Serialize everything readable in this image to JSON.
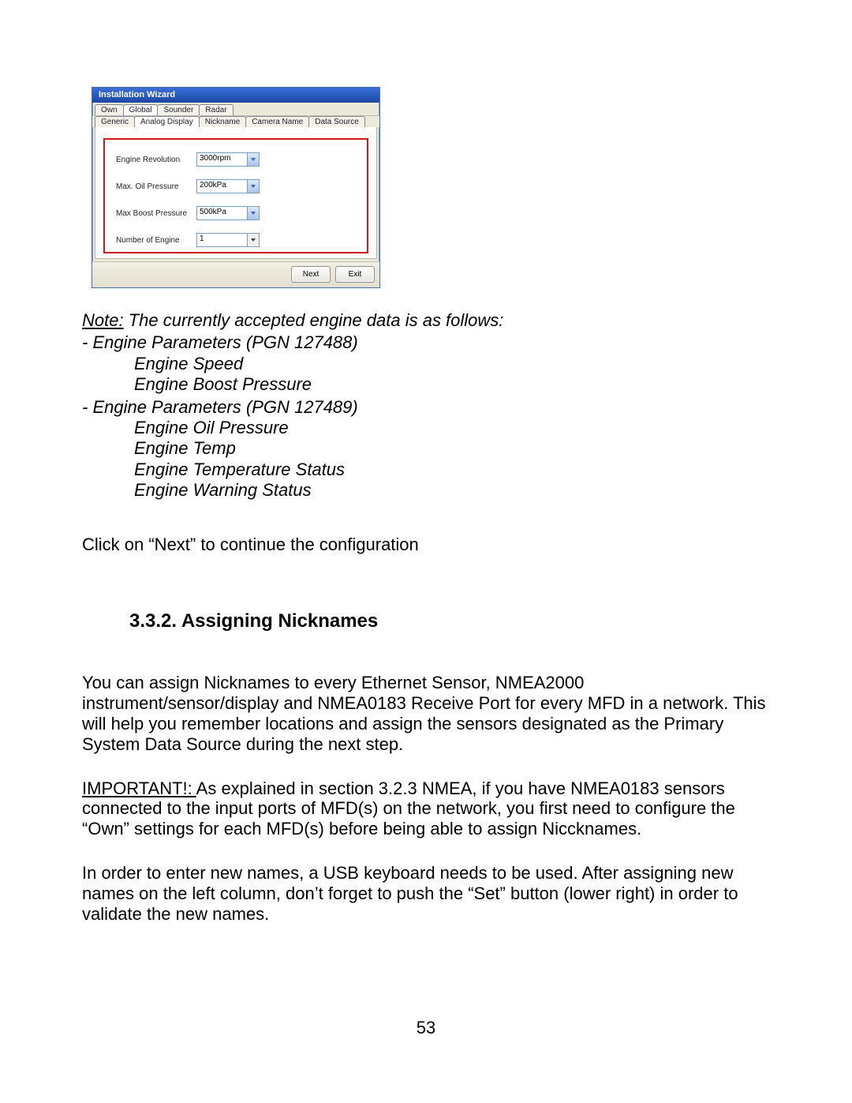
{
  "wizard": {
    "title": "Installation Wizard",
    "tabs_top": [
      "Own",
      "Global",
      "Sounder",
      "Radar"
    ],
    "active_top_index": 1,
    "tabs_sub": [
      "Generic",
      "Analog Display",
      "Nickname",
      "Camera Name",
      "Data Source"
    ],
    "active_sub_index": 1,
    "fields": [
      {
        "label": "Engine Revolution",
        "value": "3000rpm",
        "style": "blue"
      },
      {
        "label": "Max. Oil Pressure",
        "value": "200kPa",
        "style": "blue"
      },
      {
        "label": "Max Boost Pressure",
        "value": "500kPa",
        "style": "blue"
      },
      {
        "label": "Number of Engine",
        "value": "1",
        "style": "gray"
      }
    ],
    "buttons": {
      "next": "Next",
      "exit": "Exit"
    }
  },
  "note": {
    "lead_underline": "Note:",
    "lead_rest": " The currently accepted engine data is as follows:",
    "pgn1_line": "- Engine Parameters (PGN 127488)",
    "pgn1_items": [
      "Engine Speed",
      "Engine Boost Pressure"
    ],
    "pgn2_line": "- Engine Parameters (PGN 127489)",
    "pgn2_items": [
      "Engine Oil Pressure",
      "Engine Temp",
      "Engine Temperature Status",
      "Engine Warning Status"
    ]
  },
  "click_next": "Click on “Next” to continue the configuration",
  "heading": "3.3.2. Assigning Nicknames",
  "p1": "You can assign Nicknames to every Ethernet Sensor, NMEA2000 instrument/sensor/display and NMEA0183 Receive Port for every MFD in a network. This will help you remember locations and assign the sensors designated as the Primary System Data Source during the next step.",
  "p2_lead": "IMPORTANT!: ",
  "p2_rest": "As explained in section 3.2.3 NMEA, if you have NMEA0183 sensors connected to the input ports of MFD(s) on the network, you first need to configure the “Own” settings for each MFD(s) before being able to assign Niccknames.",
  "p3": "In order to enter new names, a USB keyboard needs to be used. After assigning new names on the left column, don’t forget to push the “Set” button (lower right) in order to validate the new names.",
  "page_number": "53"
}
